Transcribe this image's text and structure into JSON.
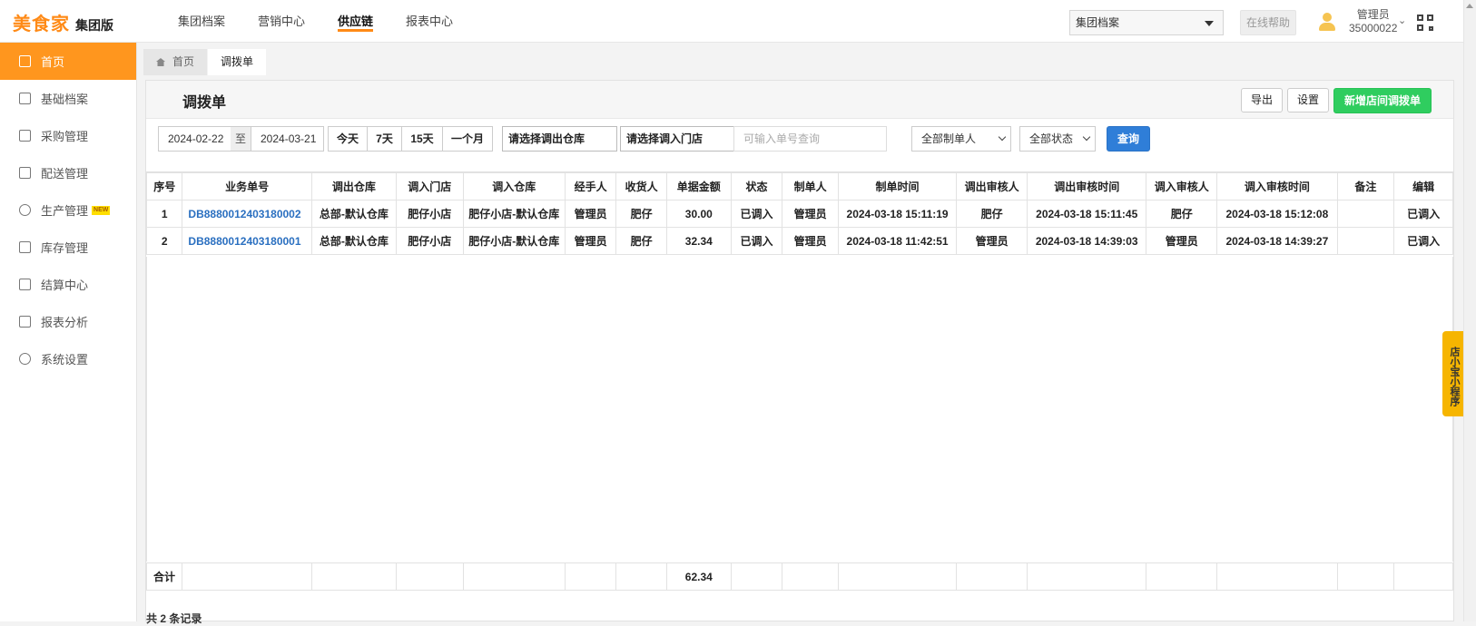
{
  "brand": {
    "logo": "美食家",
    "sub": "集团版"
  },
  "topnav": [
    "集团档案",
    "营销中心",
    "供应链",
    "报表中心"
  ],
  "org_select": "集团档案",
  "help": "在线帮助",
  "user": {
    "role": "管理员",
    "id": "35000022"
  },
  "sidebar": [
    {
      "label": "首页",
      "icon": "home-icon"
    },
    {
      "label": "基础档案",
      "icon": "archive-icon"
    },
    {
      "label": "采购管理",
      "icon": "cart-icon"
    },
    {
      "label": "配送管理",
      "icon": "truck-icon"
    },
    {
      "label": "生产管理",
      "icon": "production-icon",
      "badge": "NEW"
    },
    {
      "label": "库存管理",
      "icon": "inventory-icon"
    },
    {
      "label": "结算中心",
      "icon": "settlement-icon"
    },
    {
      "label": "报表分析",
      "icon": "report-icon"
    },
    {
      "label": "系统设置",
      "icon": "settings-icon"
    }
  ],
  "tabs": [
    "首页",
    "调拨单"
  ],
  "page": {
    "title": "调拨单",
    "export": "导出",
    "settings": "设置",
    "new_transfer": "新增店间调拨单"
  },
  "filter": {
    "date_from": "2024-02-22",
    "date_sep": "至",
    "date_to": "2024-03-21",
    "quick": [
      "今天",
      "7天",
      "15天",
      "一个月"
    ],
    "out_warehouse": "请选择调出仓库",
    "in_store": "请选择调入门店",
    "order_no_placeholder": "可输入单号查询",
    "creator": "全部制单人",
    "status": "全部状态",
    "query": "查询"
  },
  "table": {
    "headers": [
      "序号",
      "业务单号",
      "调出仓库",
      "调入门店",
      "调入仓库",
      "经手人",
      "收货人",
      "单据金额",
      "状态",
      "制单人",
      "制单时间",
      "调出审核人",
      "调出审核时间",
      "调入审核人",
      "调入审核时间",
      "备注",
      "编辑"
    ],
    "rows": [
      [
        "1",
        "DB8880012403180002",
        "总部-默认仓库",
        "肥仔小店",
        "肥仔小店-默认仓库",
        "管理员",
        "肥仔",
        "30.00",
        "已调入",
        "管理员",
        "2024-03-18 15:11:19",
        "肥仔",
        "2024-03-18 15:11:45",
        "肥仔",
        "2024-03-18 15:12:08",
        "",
        "已调入"
      ],
      [
        "2",
        "DB8880012403180001",
        "总部-默认仓库",
        "肥仔小店",
        "肥仔小店-默认仓库",
        "管理员",
        "肥仔",
        "32.34",
        "已调入",
        "管理员",
        "2024-03-18 11:42:51",
        "管理员",
        "2024-03-18 14:39:03",
        "管理员",
        "2024-03-18 14:39:27",
        "",
        "已调入"
      ]
    ],
    "total_label": "合计",
    "total_amount": "62.34"
  },
  "footnote": "共 2 条记录",
  "mini_program": "店小宝小程序",
  "colors": {
    "accent": "#ff961e",
    "primary": "#2f7ed8",
    "success": "#2fcd5f",
    "link": "#2a6fc0"
  }
}
